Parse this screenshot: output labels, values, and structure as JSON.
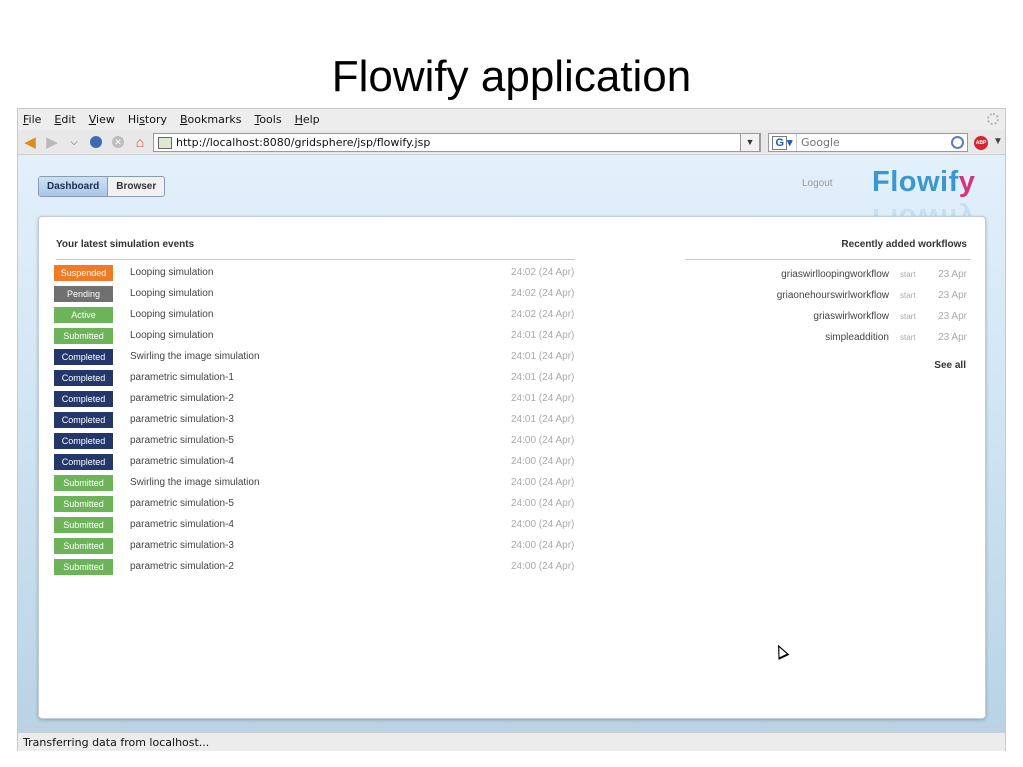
{
  "slide": {
    "title": "Flowify application"
  },
  "browser": {
    "menu": [
      {
        "u": "F",
        "rest": "ile"
      },
      {
        "u": "E",
        "rest": "dit"
      },
      {
        "u": "V",
        "rest": "iew"
      },
      {
        "pre": "Hi",
        "u": "s",
        "rest": "tory"
      },
      {
        "u": "B",
        "rest": "ookmarks"
      },
      {
        "u": "T",
        "rest": "ools"
      },
      {
        "u": "H",
        "rest": "elp"
      }
    ],
    "url": "http://localhost:8080/gridsphere/jsp/flowify.jsp",
    "search_placeholder": "Google",
    "status": "Transferring data from localhost...",
    "abp_label": "ABP"
  },
  "app": {
    "tabs": {
      "dashboard": "Dashboard",
      "browser": "Browser"
    },
    "logout": "Logout",
    "brand": {
      "main": "Flowif",
      "accent": "y"
    },
    "events_heading": "Your latest simulation events",
    "workflows_heading": "Recently added workflows",
    "see_all": "See all",
    "events": [
      {
        "status": "Suspended",
        "name": "Looping simulation",
        "time": "24:02 (24 Apr)"
      },
      {
        "status": "Pending",
        "name": "Looping simulation",
        "time": "24:02 (24 Apr)"
      },
      {
        "status": "Active",
        "name": "Looping simulation",
        "time": "24:02 (24 Apr)"
      },
      {
        "status": "Submitted",
        "name": "Looping simulation",
        "time": "24:01 (24 Apr)"
      },
      {
        "status": "Completed",
        "name": "Swirling the image simulation",
        "time": "24:01 (24 Apr)"
      },
      {
        "status": "Completed",
        "name": "parametric simulation-1",
        "time": "24:01 (24 Apr)"
      },
      {
        "status": "Completed",
        "name": "parametric simulation-2",
        "time": "24:01 (24 Apr)"
      },
      {
        "status": "Completed",
        "name": "parametric simulation-3",
        "time": "24:01 (24 Apr)"
      },
      {
        "status": "Completed",
        "name": "parametric simulation-5",
        "time": "24:00 (24 Apr)"
      },
      {
        "status": "Completed",
        "name": "parametric simulation-4",
        "time": "24:00 (24 Apr)"
      },
      {
        "status": "Submitted",
        "name": "Swirling the image simulation",
        "time": "24:00 (24 Apr)"
      },
      {
        "status": "Submitted",
        "name": "parametric simulation-5",
        "time": "24:00 (24 Apr)"
      },
      {
        "status": "Submitted",
        "name": "parametric simulation-4",
        "time": "24:00 (24 Apr)"
      },
      {
        "status": "Submitted",
        "name": "parametric simulation-3",
        "time": "24:00 (24 Apr)"
      },
      {
        "status": "Submitted",
        "name": "parametric simulation-2",
        "time": "24:00 (24 Apr)"
      }
    ],
    "workflows": [
      {
        "name": "griaswirlloopingworkflow",
        "action": "start",
        "date": "23 Apr"
      },
      {
        "name": "griaonehourswirlworkflow",
        "action": "start",
        "date": "23 Apr"
      },
      {
        "name": "griaswirlworkflow",
        "action": "start",
        "date": "23 Apr"
      },
      {
        "name": "simpleaddition",
        "action": "start",
        "date": "23 Apr"
      }
    ],
    "status_colors": {
      "Suspended": "#f07a28",
      "Pending": "#707070",
      "Active": "#6db35a",
      "Submitted": "#6db35a",
      "Completed": "#24376b"
    }
  }
}
